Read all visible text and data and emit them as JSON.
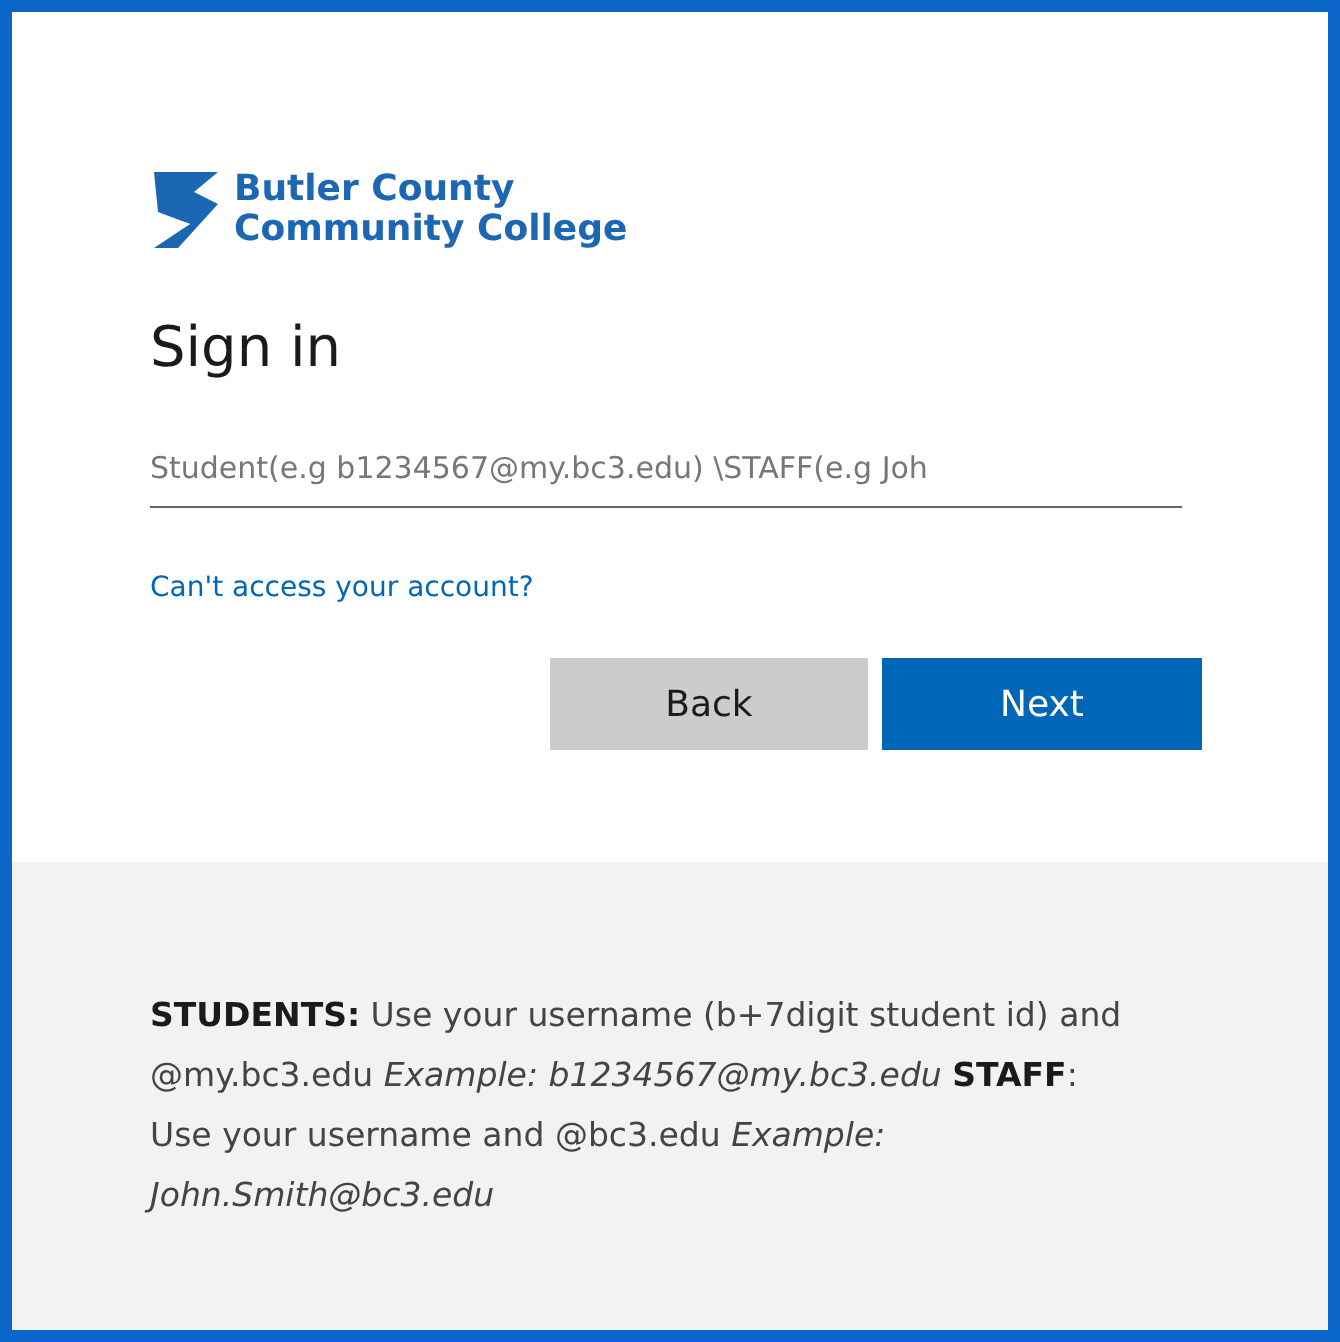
{
  "logo": {
    "line_1": "Butler County",
    "line_2": "Community College"
  },
  "title": "Sign in",
  "username_field": {
    "placeholder": "Student(e.g b1234567@my.bc3.edu) \\STAFF(e.g Joh"
  },
  "help_link": "Can't access your account?",
  "buttons": [
    {
      "label": "Back",
      "kind": "secondary"
    },
    {
      "label": "Next",
      "kind": "primary"
    }
  ],
  "footer_text": "**STUDENTS:** Use your username (b+7digit student id) and @my.bc3.edu *Example: b1234567@my.bc3.edu* **STAFF**: Use your username and @bc3.edu *Example: John.Smith@bc3.edu*"
}
